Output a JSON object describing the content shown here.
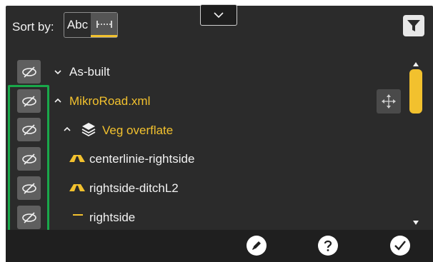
{
  "header": {
    "sort_label": "Sort by:",
    "sort_options": [
      {
        "label": "Abc",
        "selected": false
      },
      {
        "label": "",
        "icon": "distance-sort-icon",
        "selected": true
      }
    ]
  },
  "tree": {
    "items": [
      {
        "label": "As-built",
        "expanded": true,
        "color": "#f2f2f2",
        "icon": "chevron-down-icon"
      },
      {
        "label": "MikroRoad.xml",
        "expanded": true,
        "color": "#f2c12e",
        "icon": "chevron-up-icon"
      },
      {
        "label": "Veg overflate",
        "expanded": true,
        "color": "#f2c12e",
        "icon": "layers-icon"
      },
      {
        "label": "centerlinie-rightside",
        "color": "#f2f2f2",
        "icon": "surface-icon"
      },
      {
        "label": "rightside-ditchL2",
        "color": "#f2f2f2",
        "icon": "surface-icon"
      },
      {
        "label": "rightside",
        "color": "#f2f2f2",
        "icon": "line-icon"
      }
    ]
  },
  "colors": {
    "accent": "#f2c12e",
    "background": "#2b2b2b",
    "highlight": "#19a84a"
  },
  "scrollbar": {
    "position": 0.0
  }
}
